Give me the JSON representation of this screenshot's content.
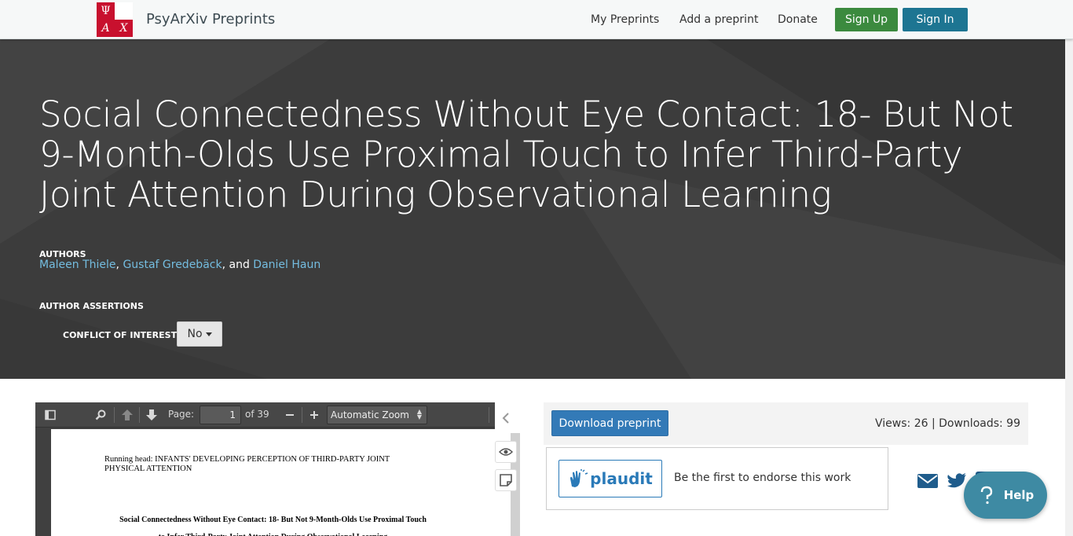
{
  "navbar": {
    "brand_name": "PsyArXiv Preprints",
    "logo_letters": [
      "Ψ",
      "",
      "A",
      "X"
    ],
    "links": [
      "My Preprints",
      "Add a preprint",
      "Donate"
    ],
    "sign_up": "Sign Up",
    "sign_in": "Sign In"
  },
  "preprint": {
    "title": "Social Connectedness Without Eye Contact: 18- But Not 9-Month-Olds Use Proximal Touch to Infer Third-Party Joint Attention During Observational Learning",
    "authors_label": "AUTHORS",
    "authors": [
      "Maleen Thiele",
      "Gustaf Gredebäck",
      "Daniel Haun"
    ],
    "author_sep1": ", ",
    "author_sep2": ", and ",
    "assertions_label": "AUTHOR ASSERTIONS",
    "coi_label": "CONFLICT OF INTEREST",
    "coi_value": "No"
  },
  "pdf_viewer": {
    "page_label": "Page:",
    "page_current": "1",
    "page_total": "of 39",
    "zoom": "Automatic Zoom",
    "running_head_1": "Running head: INFANTS' DEVELOPING PERCEPTION OF THIRD-PARTY JOINT",
    "running_head_2": "PHYSICAL ATTENTION",
    "doc_title_1": "Social Connectedness Without Eye Contact: 18- But Not 9-Month-Olds Use Proximal Touch",
    "doc_title_2": "to Infer Third-Party Joint Attention During Observational Learning"
  },
  "actions": {
    "download_label": "Download preprint",
    "stats": "Views: 26 | Downloads: 99",
    "plaudit_label": "plaudit",
    "endorse_text": "Be the first to endorse this work",
    "help_label": "Help"
  },
  "colors": {
    "sign_up": "#3b8a3e",
    "sign_in": "#1d7592",
    "link": "#74bde0",
    "header_bg": "#3c3c3c",
    "help": "#3e8aa3",
    "share": "#1f5c8c"
  }
}
